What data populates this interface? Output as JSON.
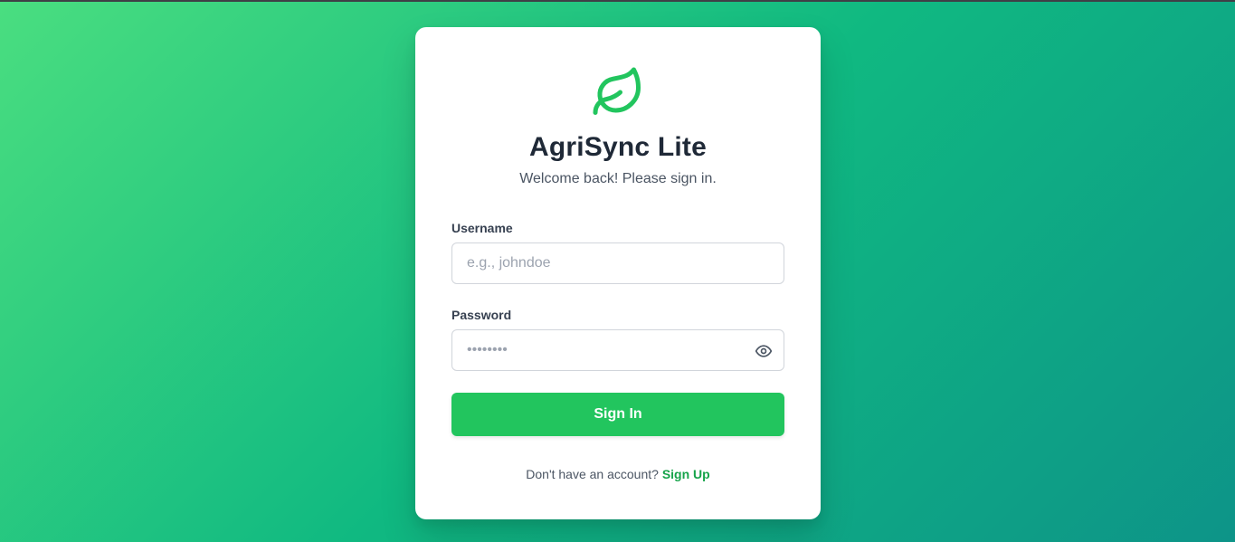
{
  "app": {
    "title": "AgriSync Lite",
    "subtitle": "Welcome back! Please sign in.",
    "logo_icon": "leaf-icon",
    "accent_color": "#22c55e"
  },
  "form": {
    "username": {
      "label": "Username",
      "placeholder": "e.g., johndoe",
      "value": ""
    },
    "password": {
      "label": "Password",
      "placeholder": "••••••••",
      "value": "",
      "toggle_icon": "eye-icon"
    },
    "submit_label": "Sign In"
  },
  "footer": {
    "prompt": "Don't have an account?",
    "link_label": "Sign Up"
  }
}
